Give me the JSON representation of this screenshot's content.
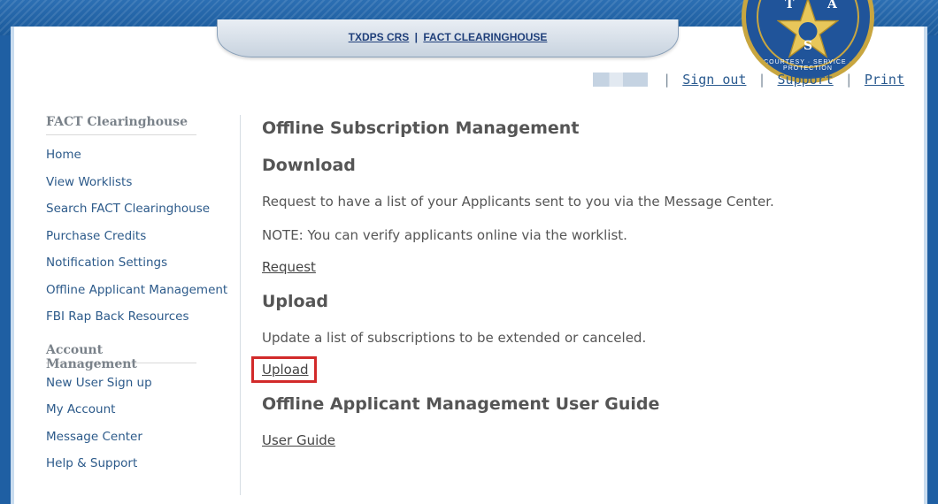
{
  "header": {
    "breadcrumb_home": "TXDPS CRS",
    "breadcrumb_separator": "|",
    "breadcrumb_current": "FACT CLEARINGHOUSE"
  },
  "seal": {
    "letters": [
      "T",
      "A",
      "S"
    ],
    "motto": "COURTESY · SERVICE · PROTECTION",
    "colors": {
      "field": "#20549a",
      "gold": "#c8a640"
    }
  },
  "top_links": {
    "separator": "|",
    "sign_out": "Sign out",
    "support": "Support",
    "print": "Print"
  },
  "sidebar": {
    "section1_title": "FACT Clearinghouse",
    "section1_items": [
      {
        "label": "Home"
      },
      {
        "label": "View Worklists"
      },
      {
        "label": "Search FACT Clearinghouse"
      },
      {
        "label": "Purchase Credits"
      },
      {
        "label": "Notification Settings"
      },
      {
        "label": "Offline Applicant Management"
      },
      {
        "label": "FBI Rap Back Resources"
      }
    ],
    "section2_title": "Account Management",
    "section2_items": [
      {
        "label": "New User Sign up"
      },
      {
        "label": "My Account"
      },
      {
        "label": "Message Center"
      },
      {
        "label": "Help & Support"
      }
    ]
  },
  "main": {
    "page_title": "Offline Subscription Management",
    "download": {
      "heading": "Download",
      "description": "Request to have a list of your Applicants sent to you via the Message Center.",
      "note": "NOTE: You can verify applicants online via the worklist.",
      "link": "Request"
    },
    "upload": {
      "heading": "Upload",
      "description": "Update a list of subscriptions to be extended or canceled.",
      "link": "Upload"
    },
    "guide": {
      "heading": "Offline Applicant Management User Guide",
      "link": "User Guide"
    }
  },
  "colors": {
    "brand_blue": "#1f5fa3",
    "link_blue": "#2c5a8a",
    "highlight_red": "#d22a2a"
  }
}
